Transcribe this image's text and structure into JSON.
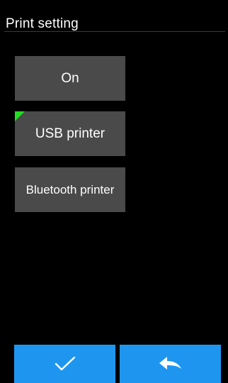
{
  "header": {
    "title": "Print setting"
  },
  "options": [
    {
      "label": "On"
    },
    {
      "label": "USB printer",
      "selected": true
    },
    {
      "label": "Bluetooth printer"
    }
  ],
  "footer": {
    "confirm_icon": "checkmark-icon",
    "back_icon": "back-arrow-icon"
  },
  "colors": {
    "background": "#000000",
    "option_background": "#4a4a4a",
    "selected_marker": "#22dd22",
    "button_accent": "#1e96f0"
  }
}
